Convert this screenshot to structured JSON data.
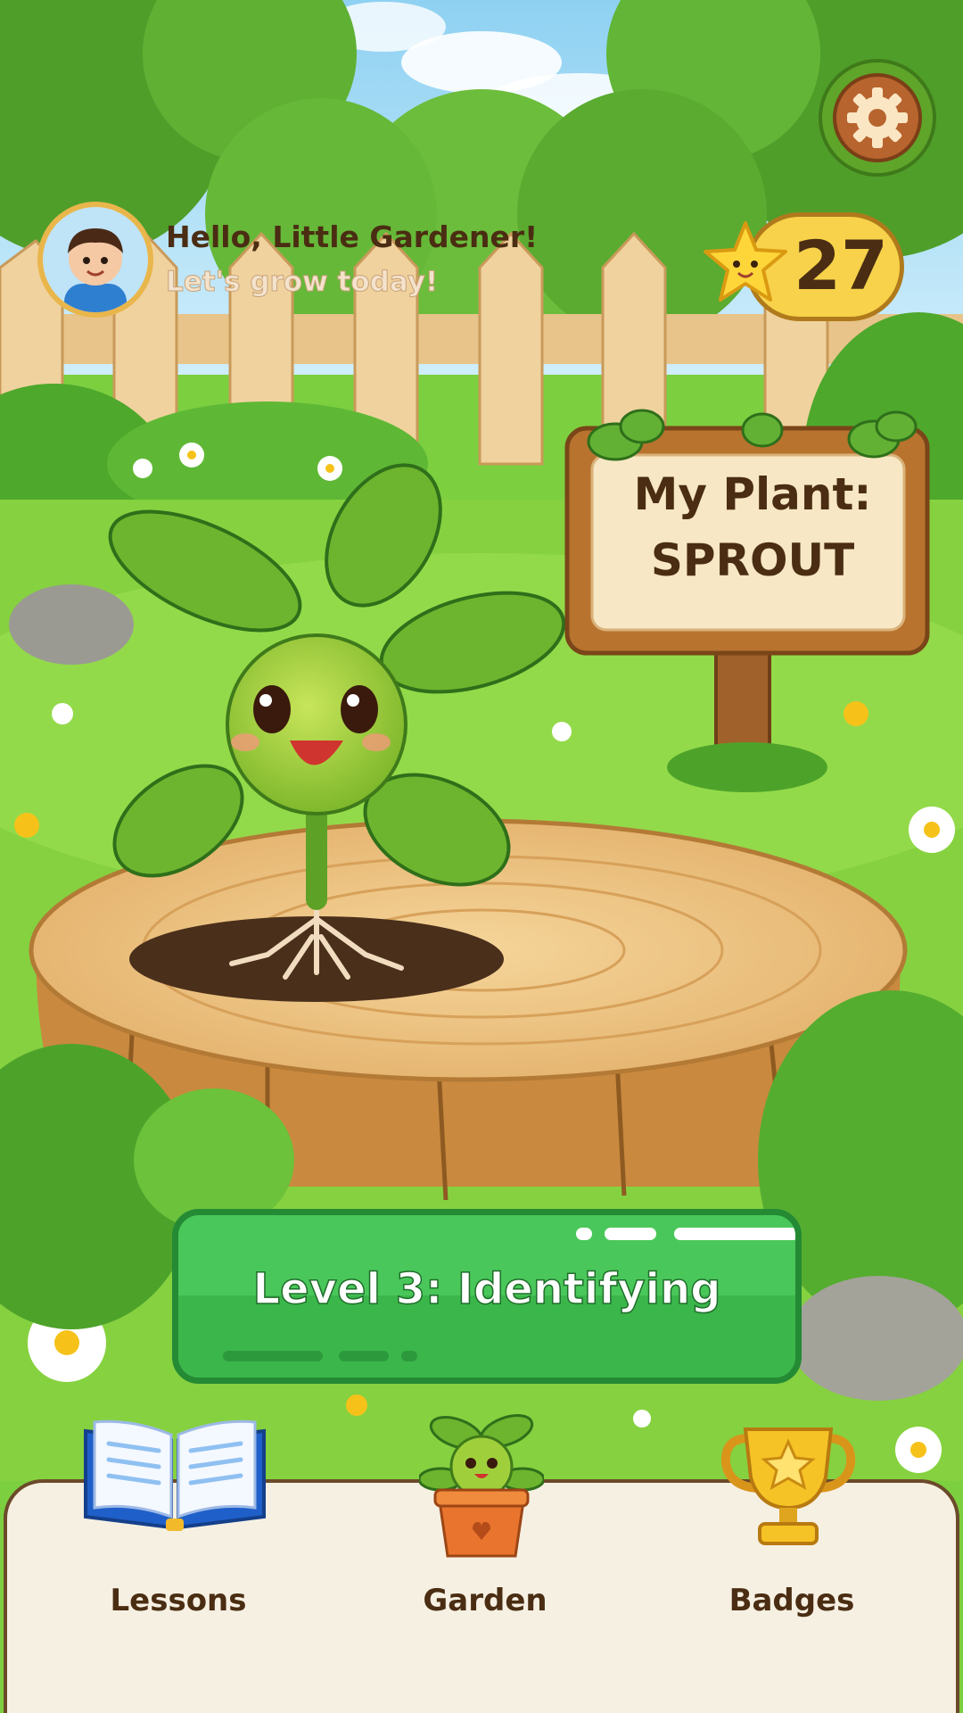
{
  "header": {
    "greeting": "Hello, Little Gardener!",
    "subgreeting": "Let's grow today!",
    "avatar_icon": "boy-avatar-icon"
  },
  "score": {
    "value": "27",
    "icon": "star-icon"
  },
  "settings": {
    "icon": "gear-icon"
  },
  "sign": {
    "line1": "My Plant:",
    "line2": "SPROUT"
  },
  "level": {
    "label": "Level 3: Identifying"
  },
  "nav": {
    "items": [
      {
        "label": "Lessons",
        "icon": "open-book-icon"
      },
      {
        "label": "Garden",
        "icon": "potted-sprout-icon"
      },
      {
        "label": "Badges",
        "icon": "trophy-icon"
      }
    ]
  },
  "colors": {
    "grass": "#7ccf3f",
    "level_green": "#4ac75a",
    "nav_bg": "#f6f0e3",
    "text_brown": "#4a2d12",
    "score_yellow": "#f7d24a"
  }
}
